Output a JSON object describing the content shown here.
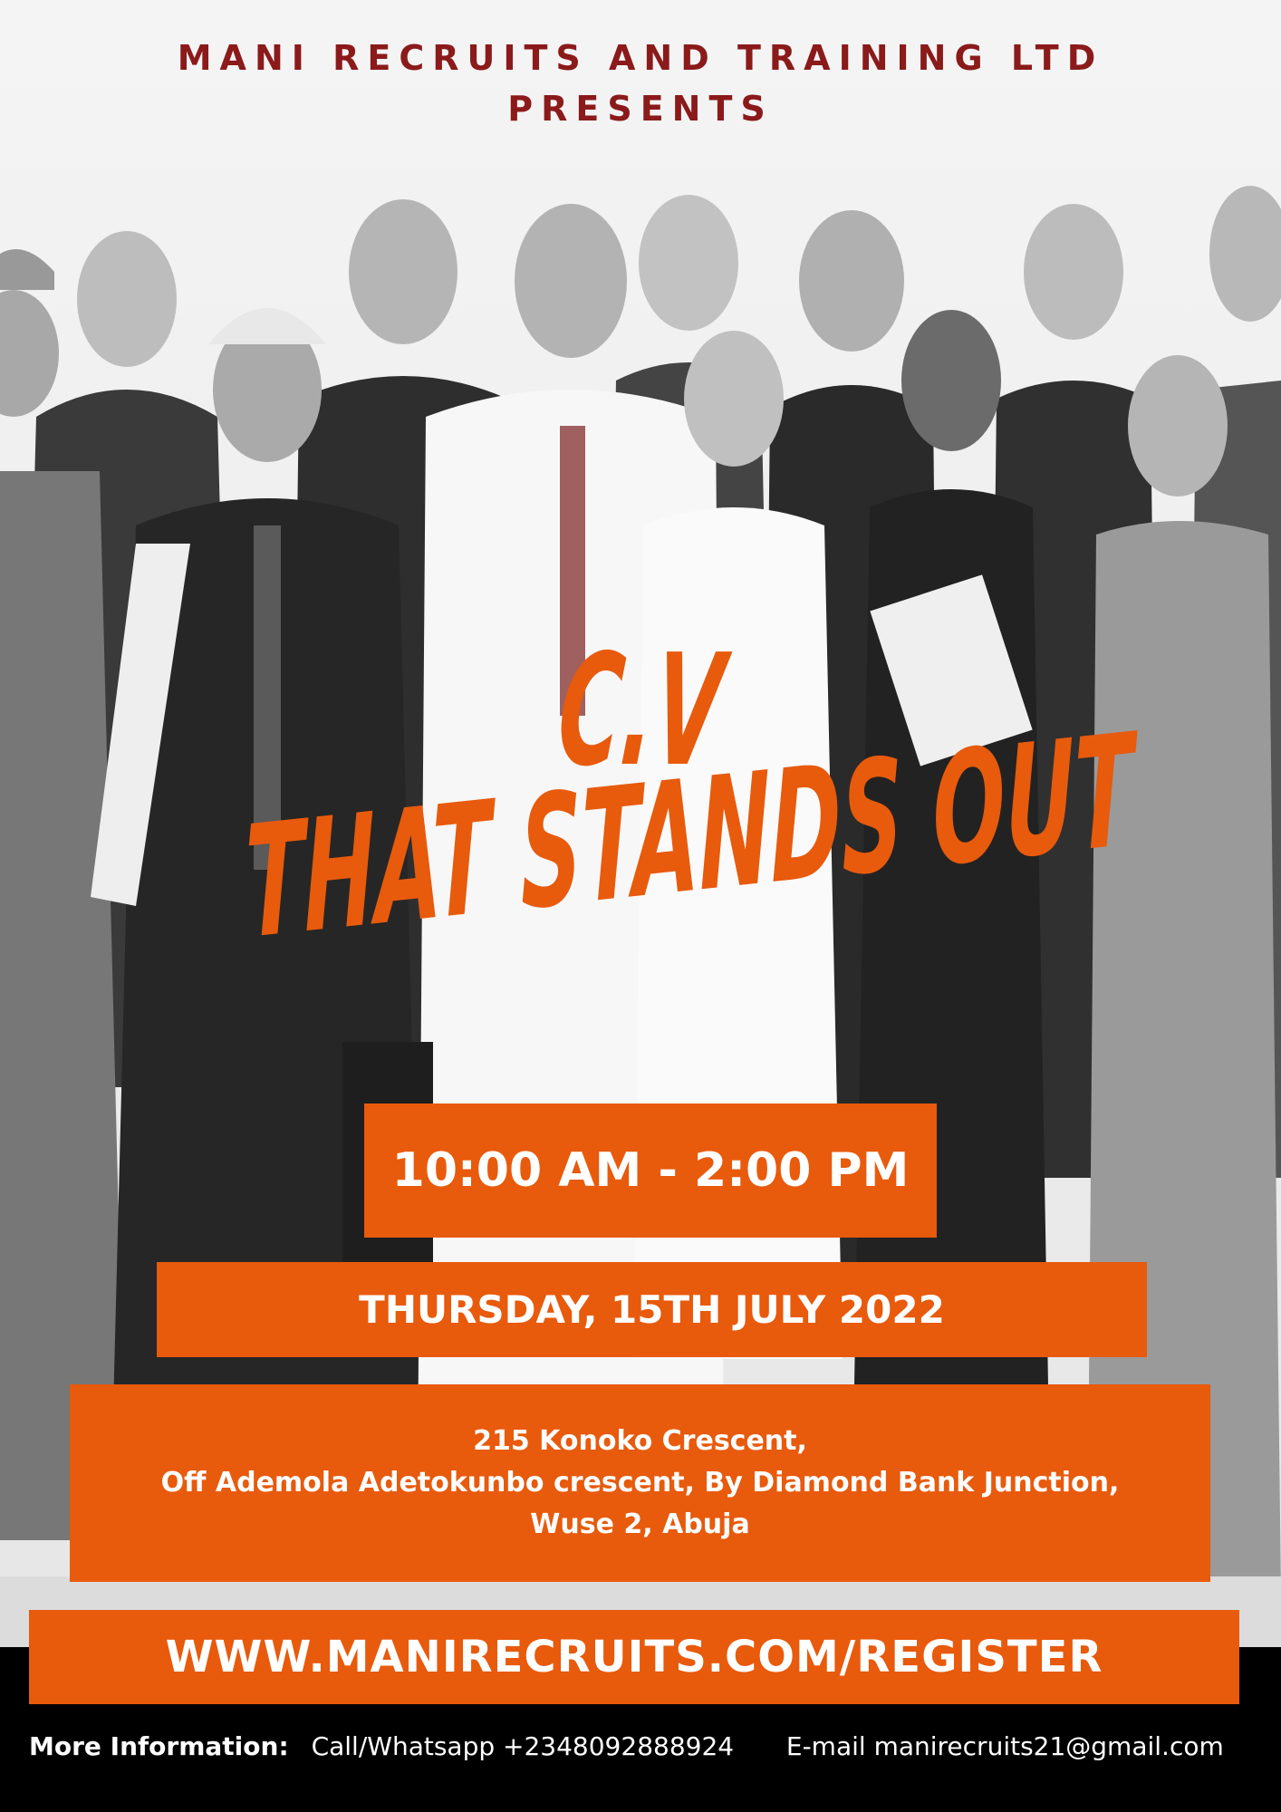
{
  "header": {
    "line1": "MANI RECRUITS AND TRAINING LTD",
    "line2": "PRESENTS"
  },
  "headline": {
    "line1": "C.V",
    "line2": "THAT STANDS OUT"
  },
  "event": {
    "time": "10:00 AM - 2:00 PM",
    "date": "THURSDAY,  15TH JULY 2022",
    "venue_line1": "215 Konoko Crescent,",
    "venue_line2": "Off Ademola Adetokunbo crescent, By Diamond Bank Junction, Wuse 2, Abuja"
  },
  "register_url": "WWW.MANIRECRUITS.COM/REGISTER",
  "contact": {
    "label": "More Information:",
    "phone": "Call/Whatsapp +2348092888924",
    "email": "E-mail  manirecruits21@gmail.com"
  },
  "colors": {
    "accent": "#e85a0c",
    "header_text": "#8b1a1a",
    "footer_bg": "#000000"
  }
}
